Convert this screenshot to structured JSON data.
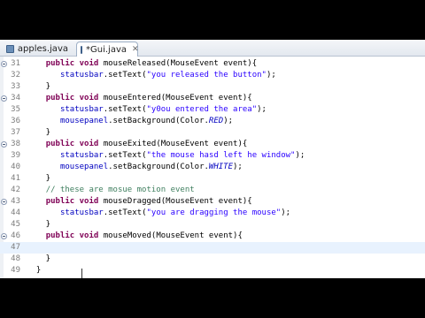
{
  "tabs": [
    {
      "label": "apples.java",
      "active": false
    },
    {
      "label": "*Gui.java",
      "active": true,
      "close": "✕"
    }
  ],
  "lines": [
    {
      "num": "31",
      "fold": true,
      "segments": [
        {
          "t": "    "
        },
        {
          "t": "public",
          "c": "kw"
        },
        {
          "t": " "
        },
        {
          "t": "void",
          "c": "kw"
        },
        {
          "t": " mouseReleased(MouseEvent event){"
        }
      ]
    },
    {
      "num": "32",
      "segments": [
        {
          "t": "       "
        },
        {
          "t": "statusbar",
          "c": "fld"
        },
        {
          "t": ".setText("
        },
        {
          "t": "\"you released the button\"",
          "c": "str"
        },
        {
          "t": ");"
        }
      ]
    },
    {
      "num": "33",
      "segments": [
        {
          "t": "    }"
        }
      ]
    },
    {
      "num": "34",
      "fold": true,
      "segments": [
        {
          "t": "    "
        },
        {
          "t": "public",
          "c": "kw"
        },
        {
          "t": " "
        },
        {
          "t": "void",
          "c": "kw"
        },
        {
          "t": " mouseEntered(MouseEvent event){"
        }
      ]
    },
    {
      "num": "35",
      "segments": [
        {
          "t": "       "
        },
        {
          "t": "statusbar",
          "c": "fld"
        },
        {
          "t": ".setText("
        },
        {
          "t": "\"y0ou entered the area\"",
          "c": "str"
        },
        {
          "t": ");"
        }
      ]
    },
    {
      "num": "36",
      "segments": [
        {
          "t": "       "
        },
        {
          "t": "mousepanel",
          "c": "fld"
        },
        {
          "t": ".setBackground(Color."
        },
        {
          "t": "RED",
          "c": "fld ital"
        },
        {
          "t": ");"
        }
      ]
    },
    {
      "num": "37",
      "segments": [
        {
          "t": "    }"
        }
      ]
    },
    {
      "num": "38",
      "fold": true,
      "segments": [
        {
          "t": "    "
        },
        {
          "t": "public",
          "c": "kw"
        },
        {
          "t": " "
        },
        {
          "t": "void",
          "c": "kw"
        },
        {
          "t": " mouseExited(MouseEvent event){"
        }
      ]
    },
    {
      "num": "39",
      "segments": [
        {
          "t": "       "
        },
        {
          "t": "statusbar",
          "c": "fld"
        },
        {
          "t": ".setText("
        },
        {
          "t": "\"the mouse hasd left he window\"",
          "c": "str"
        },
        {
          "t": ");"
        }
      ]
    },
    {
      "num": "40",
      "segments": [
        {
          "t": "       "
        },
        {
          "t": "mousepanel",
          "c": "fld"
        },
        {
          "t": ".setBackground(Color."
        },
        {
          "t": "WHITE",
          "c": "fld ital"
        },
        {
          "t": ");"
        }
      ]
    },
    {
      "num": "41",
      "segments": [
        {
          "t": "    }"
        }
      ]
    },
    {
      "num": "42",
      "segments": [
        {
          "t": "    "
        },
        {
          "t": "// these are mosue motion event",
          "c": "cmt"
        }
      ]
    },
    {
      "num": "43",
      "fold": true,
      "segments": [
        {
          "t": "    "
        },
        {
          "t": "public",
          "c": "kw"
        },
        {
          "t": " "
        },
        {
          "t": "void",
          "c": "kw"
        },
        {
          "t": " mouseDragged(MouseEvent event){"
        }
      ]
    },
    {
      "num": "44",
      "segments": [
        {
          "t": "       "
        },
        {
          "t": "statusbar",
          "c": "fld"
        },
        {
          "t": ".setText("
        },
        {
          "t": "\"you are dragging the mouse\"",
          "c": "str"
        },
        {
          "t": ");"
        }
      ]
    },
    {
      "num": "45",
      "segments": [
        {
          "t": "    }"
        }
      ]
    },
    {
      "num": "46",
      "fold": true,
      "segments": [
        {
          "t": "    "
        },
        {
          "t": "public",
          "c": "kw"
        },
        {
          "t": " "
        },
        {
          "t": "void",
          "c": "kw"
        },
        {
          "t": " mouseMoved(MouseEvent event){"
        }
      ]
    },
    {
      "num": "47",
      "current": true,
      "segments": [
        {
          "t": ""
        }
      ]
    },
    {
      "num": "48",
      "segments": [
        {
          "t": "    }"
        }
      ]
    },
    {
      "num": "49",
      "segments": [
        {
          "t": "  }"
        }
      ]
    }
  ],
  "colors": {
    "keyword": "#7f0055",
    "field": "#0000c0",
    "string": "#2a00ff",
    "comment": "#3f7f5f",
    "current_line": "#e8f2fe"
  },
  "icons": {
    "tab": "java-file-icon",
    "fold": "fold-collapse-icon"
  }
}
